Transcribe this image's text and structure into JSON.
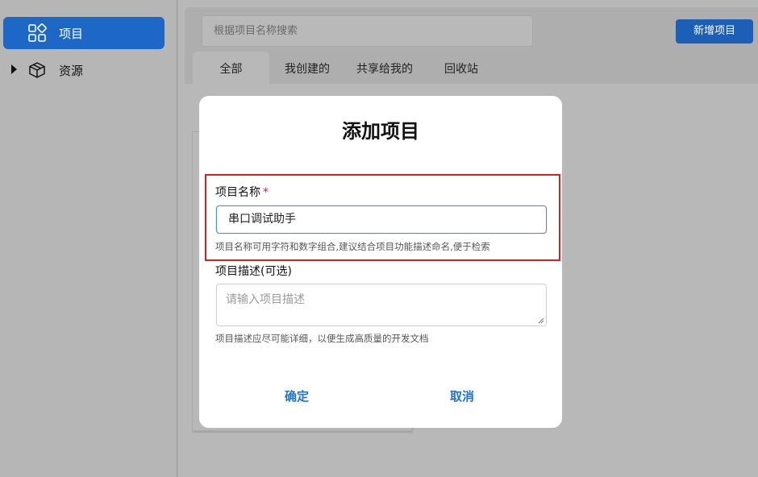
{
  "sidebar": {
    "items": [
      {
        "label": "项目",
        "icon": "grid-apps-icon",
        "active": true
      },
      {
        "label": "资源",
        "icon": "box-icon",
        "expandable": true
      }
    ]
  },
  "header": {
    "search_placeholder": "根据项目名称搜索",
    "new_button": "新增项目",
    "tabs": [
      "全部",
      "我创建的",
      "共享给我的",
      "回收站"
    ],
    "active_tab": "全部"
  },
  "modal": {
    "title": "添加项目",
    "name_label": "项目名称",
    "required_mark": "*",
    "name_value": "串口调试助手",
    "name_hint": "项目名称可用字符和数字组合,建议结合项目功能描述命名,便于检索",
    "desc_label": "项目描述(可选)",
    "desc_placeholder": "请输入项目描述",
    "desc_hint": "项目描述应尽可能详细，以便生成高质量的开发文档",
    "confirm": "确定",
    "cancel": "取消"
  },
  "colors": {
    "accent": "#1e72d6",
    "highlight_border": "#d51f2a",
    "overlay_bg": "#b8b8b8"
  }
}
